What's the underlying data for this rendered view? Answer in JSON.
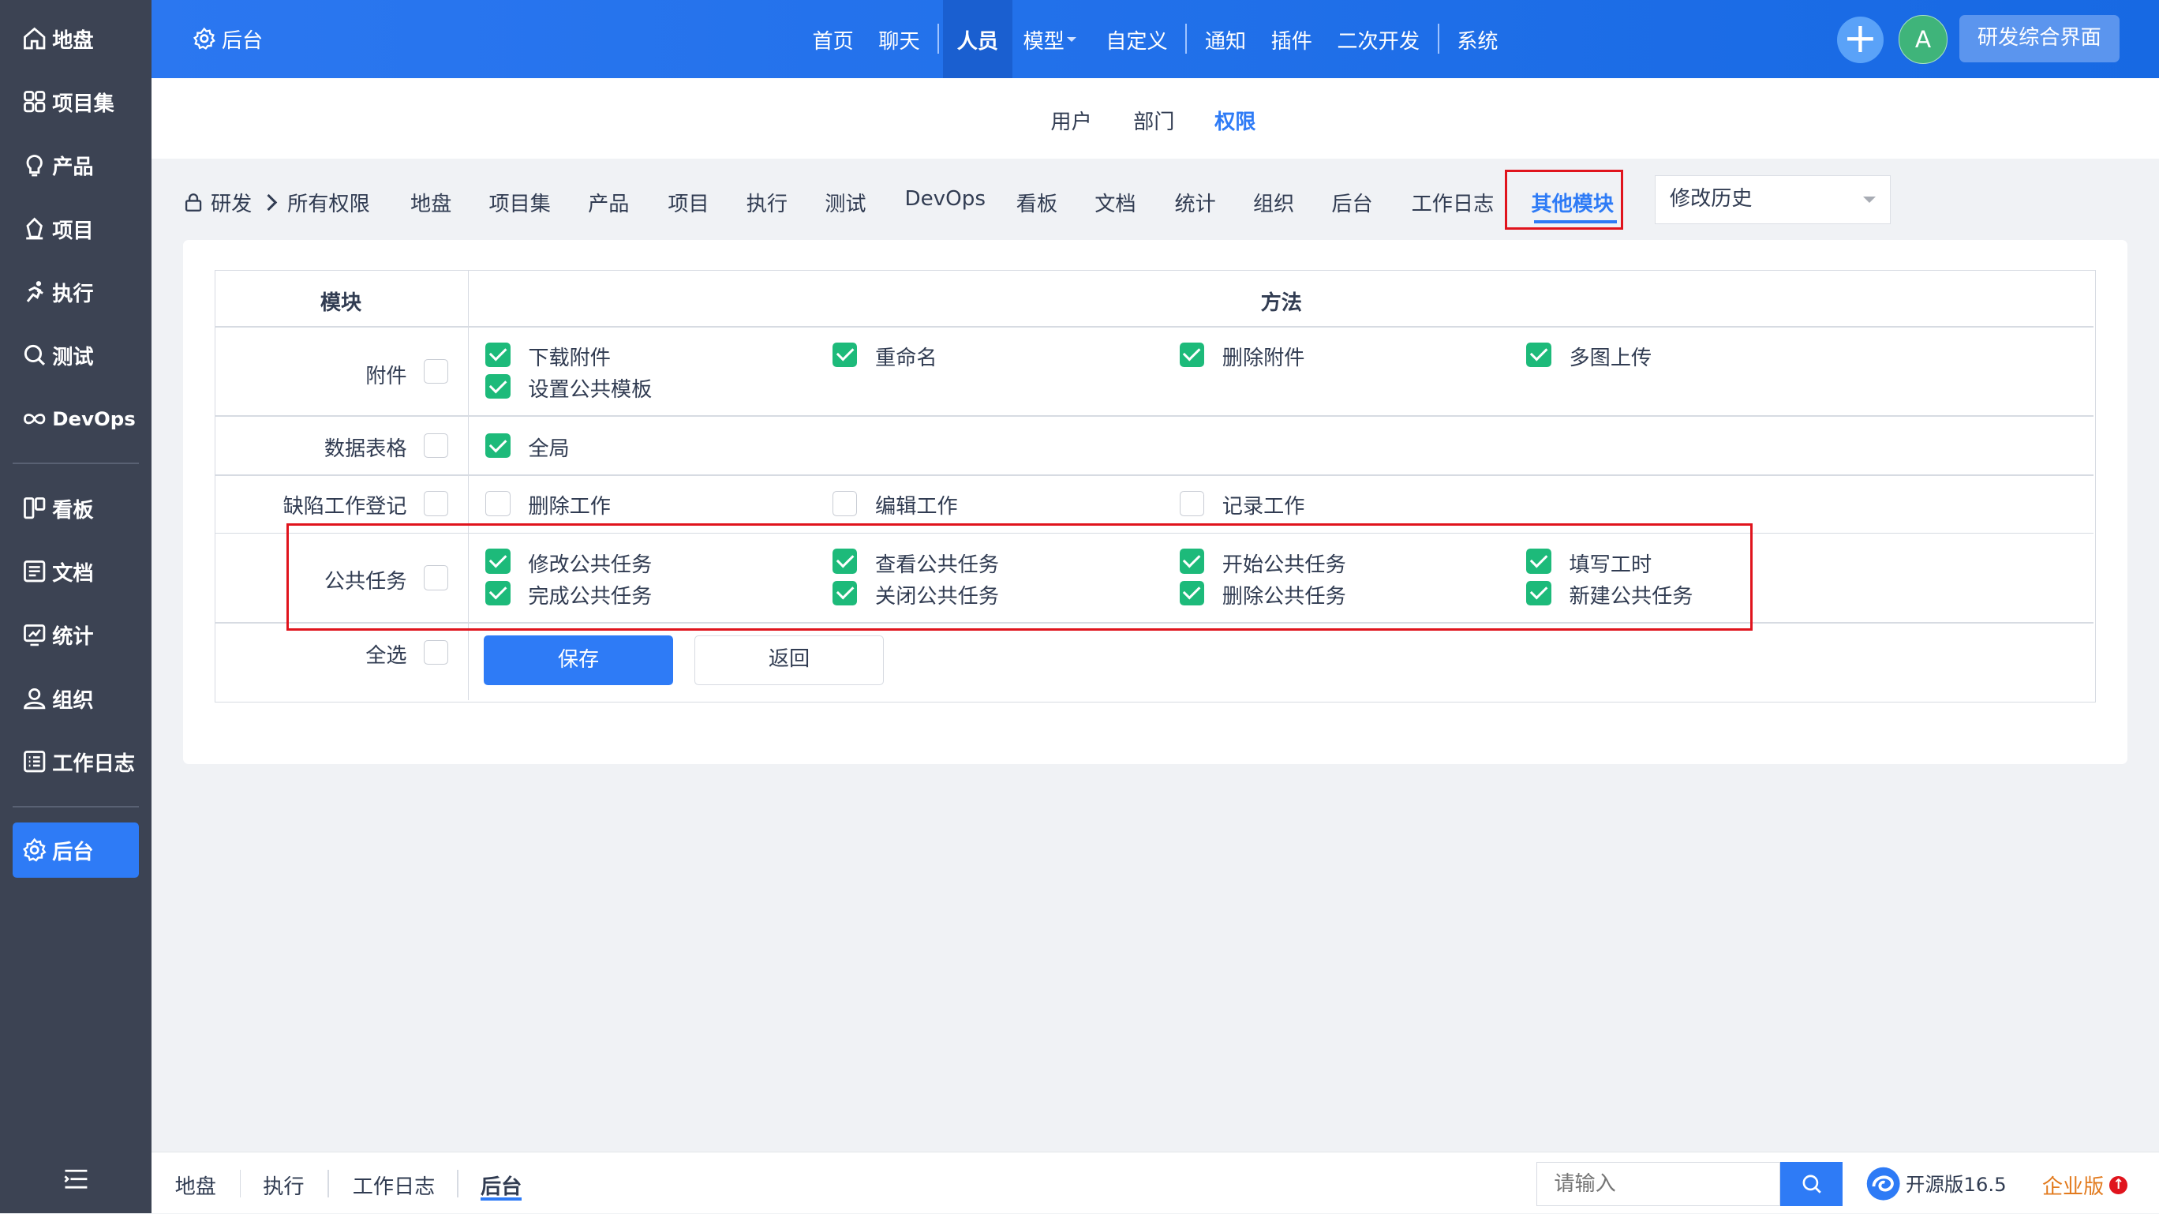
{
  "sidebar": {
    "items": [
      {
        "label": "地盘",
        "icon": "home-icon"
      },
      {
        "label": "项目集",
        "icon": "grid-icon"
      },
      {
        "label": "产品",
        "icon": "lightbulb-icon"
      },
      {
        "label": "项目",
        "icon": "project-icon"
      },
      {
        "label": "执行",
        "icon": "run-icon"
      },
      {
        "label": "测试",
        "icon": "search-icon"
      },
      {
        "label": "DevOps",
        "icon": "infinity-icon"
      },
      {
        "label": "看板",
        "icon": "kanban-icon"
      },
      {
        "label": "文档",
        "icon": "doc-icon"
      },
      {
        "label": "统计",
        "icon": "chart-icon"
      },
      {
        "label": "组织",
        "icon": "user-icon"
      },
      {
        "label": "工作日志",
        "icon": "log-icon"
      },
      {
        "label": "后台",
        "icon": "gear-icon"
      }
    ],
    "active": "后台"
  },
  "header": {
    "brand": "后台",
    "nav": [
      "首页",
      "聊天",
      "人员",
      "模型",
      "自定义",
      "通知",
      "插件",
      "二次开发",
      "系统"
    ],
    "active": "人员",
    "avatar_letter": "A",
    "rd_label": "研发综合界面"
  },
  "subtabs": [
    "用户",
    "部门",
    "权限"
  ],
  "subtabs_active": "权限",
  "breadcrumb": {
    "root": "研发",
    "current": "所有权限"
  },
  "module_tabs": [
    "地盘",
    "项目集",
    "产品",
    "项目",
    "执行",
    "测试",
    "DevOps",
    "看板",
    "文档",
    "统计",
    "组织",
    "后台",
    "工作日志",
    "其他模块"
  ],
  "module_tabs_active": "其他模块",
  "history_select": "修改历史",
  "table": {
    "head_module": "模块",
    "head_method": "方法",
    "rows": [
      {
        "module": "附件",
        "checked": false,
        "methods": [
          {
            "label": "下载附件",
            "checked": true
          },
          {
            "label": "重命名",
            "checked": true
          },
          {
            "label": "删除附件",
            "checked": true
          },
          {
            "label": "多图上传",
            "checked": true
          },
          {
            "label": "设置公共模板",
            "checked": true
          }
        ]
      },
      {
        "module": "数据表格",
        "checked": false,
        "methods": [
          {
            "label": "全局",
            "checked": true
          }
        ]
      },
      {
        "module": "缺陷工作登记",
        "checked": false,
        "methods": [
          {
            "label": "删除工作",
            "checked": false
          },
          {
            "label": "编辑工作",
            "checked": false
          },
          {
            "label": "记录工作",
            "checked": false
          }
        ]
      },
      {
        "module": "公共任务",
        "checked": false,
        "methods": [
          {
            "label": "修改公共任务",
            "checked": true
          },
          {
            "label": "查看公共任务",
            "checked": true
          },
          {
            "label": "开始公共任务",
            "checked": true
          },
          {
            "label": "填写工时",
            "checked": true
          },
          {
            "label": "完成公共任务",
            "checked": true
          },
          {
            "label": "关闭公共任务",
            "checked": true
          },
          {
            "label": "删除公共任务",
            "checked": true
          },
          {
            "label": "新建公共任务",
            "checked": true
          }
        ]
      }
    ],
    "select_all": "全选",
    "save": "保存",
    "back": "返回"
  },
  "footer": {
    "tabs": [
      "地盘",
      "执行",
      "工作日志",
      "后台"
    ],
    "active": "后台",
    "search_placeholder": "请输入",
    "version": "开源版16.5",
    "enterprise": "企业版",
    "enterprise_badge": "↑"
  },
  "colors": {
    "accent": "#2e7bf6",
    "sidebar": "#3c4353",
    "checked": "#1dba7a",
    "highlight": "#e0141d"
  }
}
